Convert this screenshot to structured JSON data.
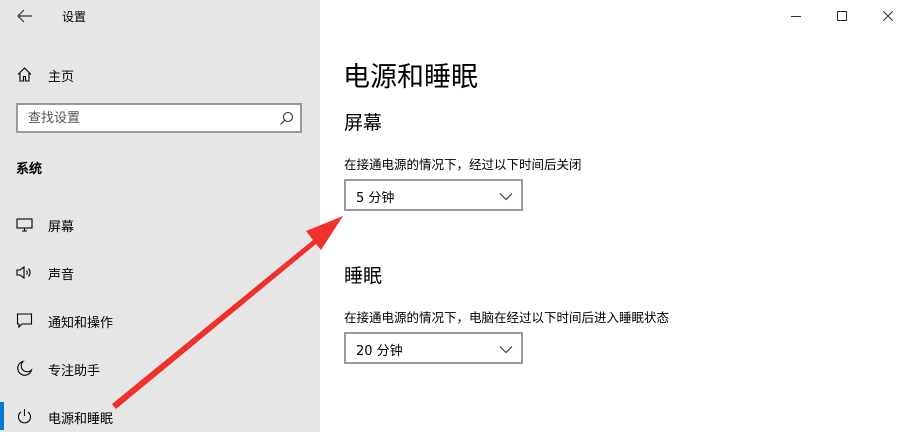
{
  "window": {
    "title": "设置",
    "controls": [
      "minimize-icon",
      "maximize-icon",
      "close-icon"
    ]
  },
  "sidebar": {
    "home_label": "主页",
    "search_placeholder": "查找设置",
    "section_title": "系统",
    "items": [
      {
        "label": "屏幕",
        "icon": "monitor-icon"
      },
      {
        "label": "声音",
        "icon": "speaker-icon"
      },
      {
        "label": "通知和操作",
        "icon": "notification-icon"
      },
      {
        "label": "专注助手",
        "icon": "moon-icon"
      },
      {
        "label": "电源和睡眠",
        "icon": "power-icon",
        "active": true
      }
    ]
  },
  "main": {
    "title": "电源和睡眠",
    "screen": {
      "heading": "屏幕",
      "description": "在接通电源的情况下，经过以下时间后关闭",
      "selected": "5 分钟"
    },
    "sleep": {
      "heading": "睡眠",
      "description": "在接通电源的情况下，电脑在经过以下时间后进入睡眠状态",
      "selected": "20 分钟"
    }
  },
  "colors": {
    "sidebar_bg": "#e6e6e6",
    "accent": "#0078d7",
    "annotation_arrow": "#f0302a"
  }
}
